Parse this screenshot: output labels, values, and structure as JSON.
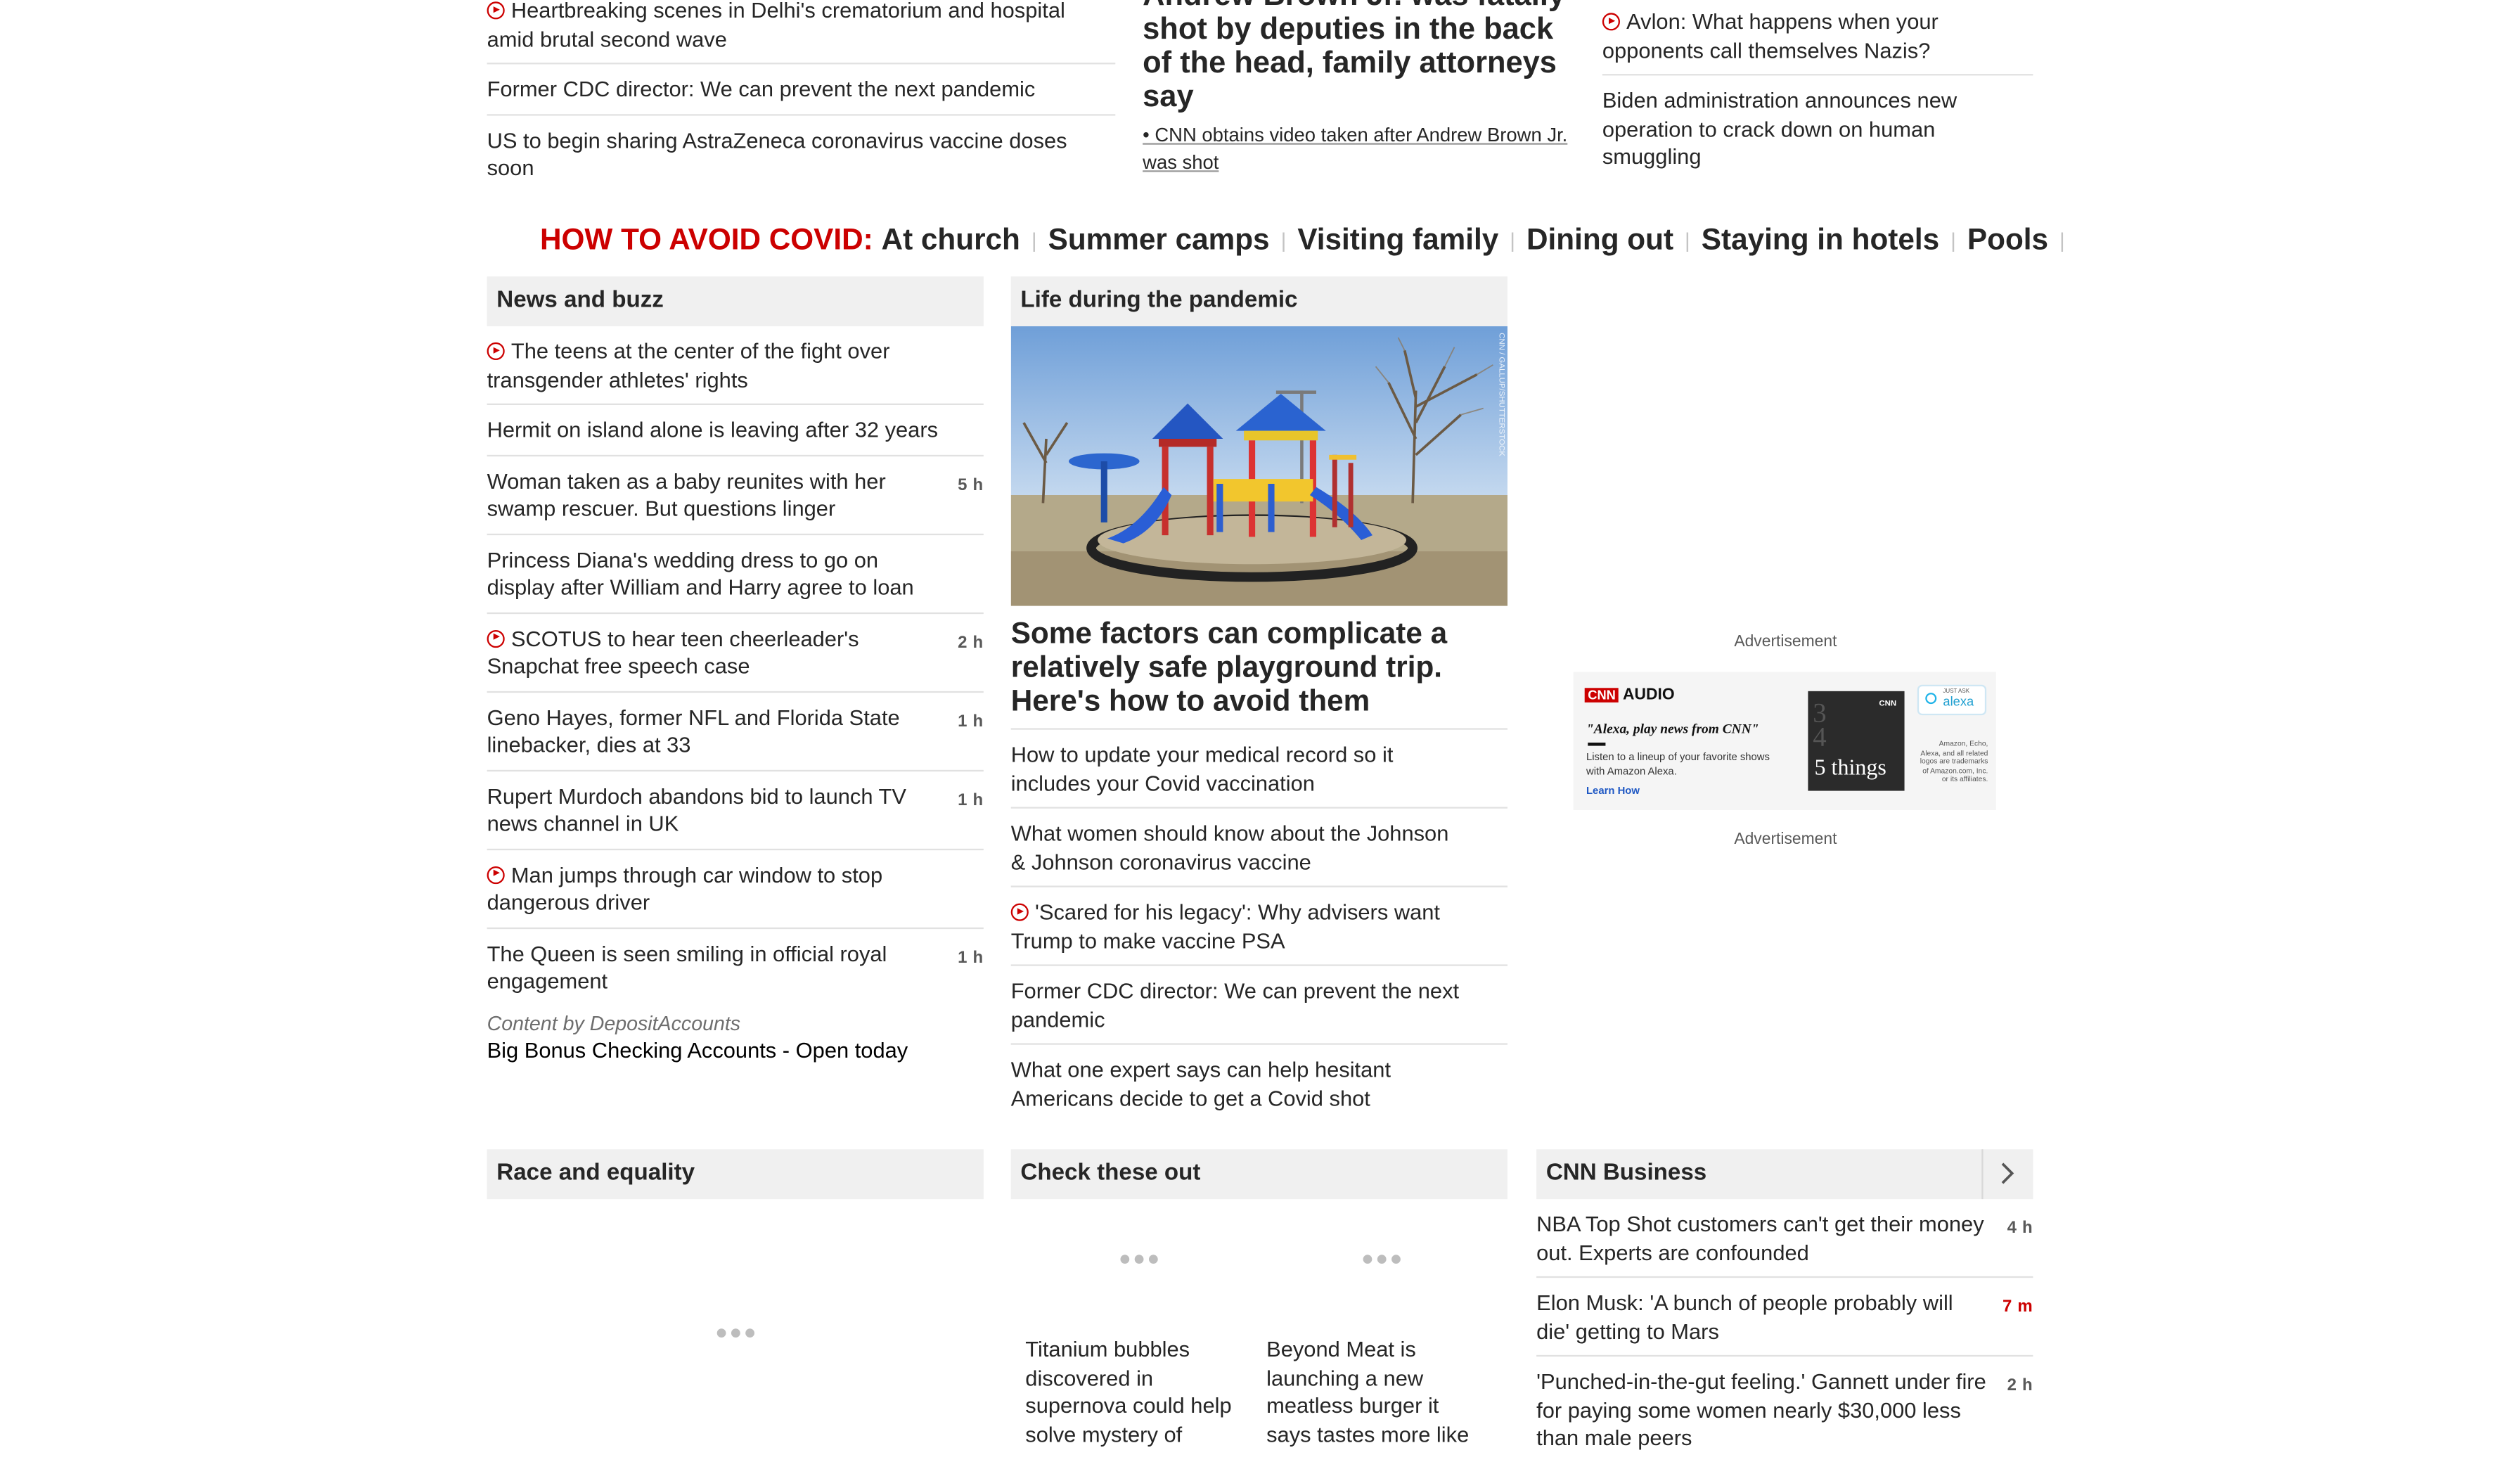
{
  "top": {
    "left_items": [
      {
        "text": "Heartbreaking scenes in Delhi's crematorium and hospital amid brutal second wave",
        "video": true
      },
      {
        "text": "Former CDC director: We can prevent the next pandemic",
        "video": false
      },
      {
        "text": "US to begin sharing AstraZeneca coronavirus vaccine doses soon",
        "video": false
      }
    ],
    "center_headline": "Andrew Brown Jr. was fatally shot by deputies in the back of the head, family attorneys say",
    "center_sub": "• CNN obtains video taken after Andrew Brown Jr. was shot",
    "right_items": [
      {
        "text": "Avlon: What happens when your opponents call themselves Nazis?",
        "video": true
      },
      {
        "text": "Biden administration announces new operation to crack down on human smuggling",
        "video": false
      }
    ]
  },
  "howto": {
    "label": "HOW TO AVOID COVID:",
    "links": [
      "At church",
      "Summer camps",
      "Visiting family",
      "Dining out",
      "Staying in hotels",
      "Pools"
    ]
  },
  "news_buzz": {
    "title": "News and buzz",
    "items": [
      {
        "text": "The teens at the center of the fight over transgender athletes' rights",
        "video": true,
        "time": ""
      },
      {
        "text": "Hermit on island alone is leaving after 32 years",
        "video": false,
        "time": ""
      },
      {
        "text": "Woman taken as a baby reunites with her swamp rescuer. But questions linger",
        "video": false,
        "time": "5 h"
      },
      {
        "text": "Princess Diana's wedding dress to go on display after William and Harry agree to loan",
        "video": false,
        "time": ""
      },
      {
        "text": "SCOTUS to hear teen cheerleader's Snapchat free speech case",
        "video": true,
        "time": "2 h"
      },
      {
        "text": "Geno Hayes, former NFL and Florida State linebacker, dies at 33",
        "video": false,
        "time": "1 h"
      },
      {
        "text": "Rupert Murdoch abandons bid to launch TV news channel in UK",
        "video": false,
        "time": "1 h"
      },
      {
        "text": "Man jumps through car window to stop dangerous driver",
        "video": true,
        "time": ""
      },
      {
        "text": "The Queen is seen smiling in official royal engagement",
        "video": false,
        "time": "1 h"
      }
    ],
    "sponsor_label": "Content by DepositAccounts",
    "sponsor_link": "Big Bonus Checking Accounts - Open today"
  },
  "pandemic": {
    "title": "Life during the pandemic",
    "image_credit": "CNN / GALLUP/SHUTTERSTOCK",
    "headline": "Some factors can complicate a relatively safe playground trip. Here's how to avoid them",
    "items": [
      {
        "text": "How to update your medical record so it includes your Covid vaccination",
        "video": false
      },
      {
        "text": "What women should know about the Johnson & Johnson coronavirus vaccine",
        "video": false
      },
      {
        "text": "'Scared for his legacy': Why advisers want Trump to make vaccine PSA",
        "video": true
      },
      {
        "text": "Former CDC director: We can prevent the next pandemic",
        "video": false
      },
      {
        "text": "What one expert says can help hesitant Americans decide to get a Covid shot",
        "video": false
      }
    ]
  },
  "ad": {
    "label_top": "Advertisement",
    "label_bottom": "Advertisement",
    "brand": "CNN",
    "audio": "AUDIO",
    "quote": "\"Alexa, play news from CNN\"",
    "desc": "Listen to a lineup of your favorite shows with Amazon Alexa.",
    "learn": "Learn How",
    "five": "5 things",
    "just_ask": "JUST ASK",
    "alexa": "alexa",
    "legal": "Amazon, Echo, Alexa, and all related logos are trademarks of Amazon.com, Inc. or its affiliates."
  },
  "race": {
    "title": "Race and equality"
  },
  "check": {
    "title": "Check these out",
    "cards": [
      {
        "text": "Titanium bubbles discovered in supernova could help solve mystery of"
      },
      {
        "text": "Beyond Meat is launching a new meatless burger it says tastes more like"
      }
    ]
  },
  "business": {
    "title": "CNN Business",
    "items": [
      {
        "text": "NBA Top Shot customers can't get their money out. Experts are confounded",
        "time": "4 h",
        "red": false
      },
      {
        "text": "Elon Musk: 'A bunch of people probably will die' getting to Mars",
        "time": "7 m",
        "red": true
      },
      {
        "text": "'Punched-in-the-gut feeling.' Gannett under fire for paying some women nearly $30,000 less than male peers",
        "time": "2 h",
        "red": false
      }
    ]
  },
  "colors": {
    "accent": "#cc0000",
    "header_bg": "#f0f0f0",
    "text": "#262626"
  }
}
